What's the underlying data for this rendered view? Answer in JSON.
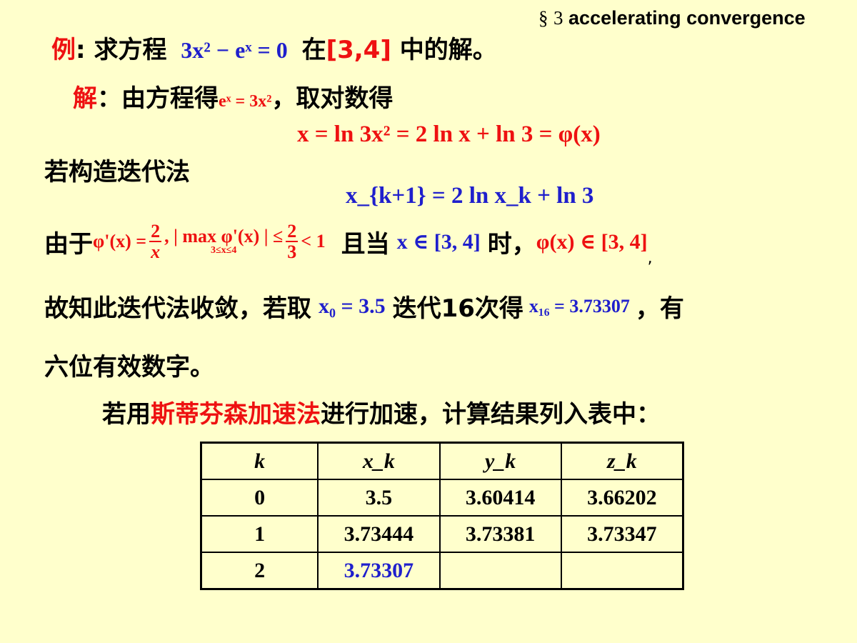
{
  "header": {
    "section_symbol": "§",
    "section_number": "3",
    "section_text": "accelerating convergence"
  },
  "example": {
    "label": "例",
    "colon": ":",
    "prefix": "求方程",
    "equation": "3x² − eˣ = 0",
    "mid": "在",
    "interval": "[3,4]",
    "suffix": "中的解。"
  },
  "solution": {
    "label": "解",
    "colon": "：",
    "text1": "由方程得",
    "eq": "eˣ = 3x²",
    "text2": "，取对数得"
  },
  "log_equation": "x = ln 3x² = 2 ln x + ln 3 = φ(x)",
  "construct_text": "若构造迭代法",
  "iteration_formula": "x_{k+1} = 2 ln x_k + ln 3",
  "derivative": {
    "prefix": "由于",
    "phi_prime": "φ'(x) =",
    "frac1_num": "2",
    "frac1_den": "x",
    "max_text": ", | max φ'(x) | ≤",
    "max_sub": "3≤x≤4",
    "frac2_num": "2",
    "frac2_den": "3",
    "lt_one": "< 1",
    "comma": ",",
    "and_when": "且当",
    "x_in": "x ∈ [3, 4]",
    "when": "时，",
    "phi_in": "φ(x) ∈ [3, 4]",
    "tail_comma": ","
  },
  "convergence": {
    "text1": "故知此迭代法收敛，若取",
    "x0": "x₀ = 3.5",
    "text2": "迭代16次得",
    "x16": "x₁₆ = 3.73307",
    "text3": "，有",
    "line2": "六位有效数字。"
  },
  "steffensen": {
    "prefix": "若用",
    "method": "斯蒂芬森加速法",
    "suffix": "进行加速，计算结果列入表中："
  },
  "table": {
    "headers": [
      "k",
      "x_k",
      "y_k",
      "z_k"
    ],
    "rows": [
      [
        "0",
        "3.5",
        "3.60414",
        "3.66202"
      ],
      [
        "1",
        "3.73444",
        "3.73381",
        "3.73347"
      ],
      [
        "2",
        "3.73307",
        "",
        ""
      ]
    ]
  },
  "colors": {
    "background": "#ffffcc",
    "red": "#ee1111",
    "blue": "#1f1fcc"
  }
}
